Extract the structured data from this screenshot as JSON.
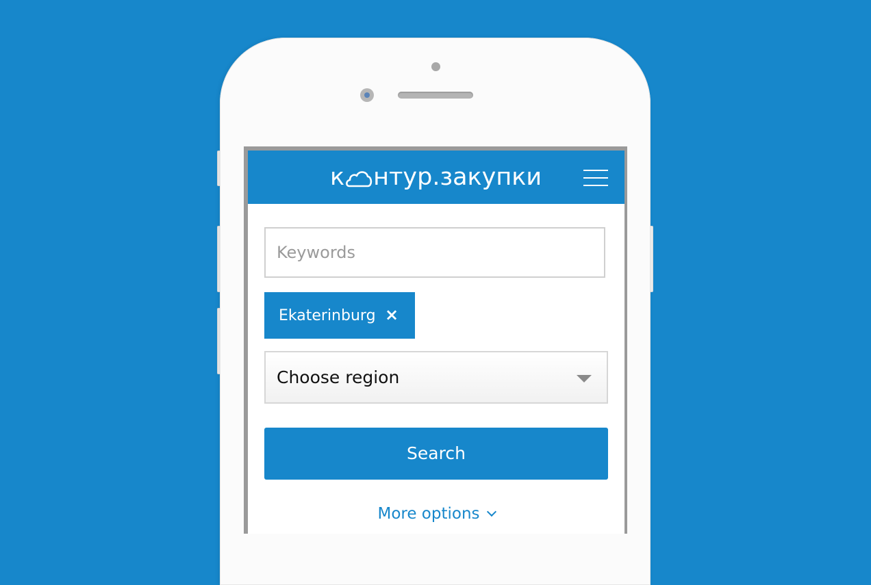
{
  "brand": {
    "logo_prefix": "к",
    "logo_suffix": "нтур.закупки",
    "color": "#1787cb"
  },
  "form": {
    "keywords_placeholder": "Keywords",
    "keywords_value": "",
    "selected_city": "Ekaterinburg",
    "remove_icon": "×",
    "region_label": "Choose region",
    "search_label": "Search",
    "more_options_label": "More options"
  }
}
